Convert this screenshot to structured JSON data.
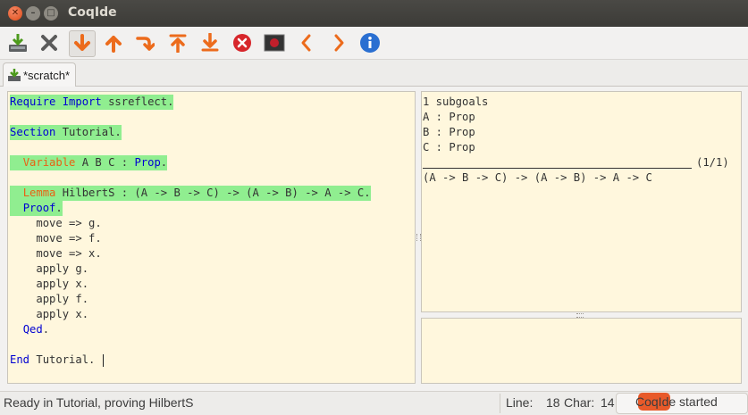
{
  "window": {
    "title": "CoqIde"
  },
  "toolbar": {
    "buttons": [
      {
        "name": "save-icon",
        "tooltip": ""
      },
      {
        "name": "close-icon",
        "tooltip": ""
      },
      {
        "name": "forward-one-icon",
        "tooltip": ""
      },
      {
        "name": "backward-one-icon",
        "tooltip": ""
      },
      {
        "name": "go-to-cursor-icon",
        "tooltip": ""
      },
      {
        "name": "restart-icon",
        "tooltip": ""
      },
      {
        "name": "go-to-end-icon",
        "tooltip": ""
      },
      {
        "name": "interrupt-icon",
        "tooltip": ""
      },
      {
        "name": "stop-icon",
        "tooltip": ""
      },
      {
        "name": "previous-icon",
        "tooltip": ""
      },
      {
        "name": "next-icon",
        "tooltip": ""
      },
      {
        "name": "about-icon",
        "tooltip": ""
      }
    ]
  },
  "tabs": [
    {
      "label": "*scratch*"
    }
  ],
  "editor": {
    "lines": [
      {
        "kw": "Require Import",
        "kw_color": "blue",
        "rest": " ssreflect.",
        "processed": true
      },
      {
        "kw": "",
        "rest": "",
        "processed": false
      },
      {
        "kw": "Section",
        "kw_color": "blue",
        "rest": " Tutorial.",
        "processed": true
      },
      {
        "kw": "",
        "rest": "",
        "processed": false
      },
      {
        "indent": "  ",
        "kw": "Variable",
        "kw_color": "orange",
        "rest": " A B C : ",
        "kw2": "Prop",
        "rest2": ".",
        "processed": true
      },
      {
        "kw": "",
        "rest": "",
        "processed": false
      },
      {
        "indent": "  ",
        "kw": "Lemma",
        "kw_color": "orange",
        "rest": " HilbertS : (A -> B -> C) -> (A -> B) -> A -> C.",
        "processed": true
      },
      {
        "indent": "  ",
        "kw": "Proof",
        "kw_color": "blue",
        "rest": ".",
        "processed": true
      },
      {
        "indent": "    ",
        "kw": "",
        "rest": "move => g.",
        "processed": false
      },
      {
        "indent": "    ",
        "kw": "",
        "rest": "move => f.",
        "processed": false
      },
      {
        "indent": "    ",
        "kw": "",
        "rest": "move => x.",
        "processed": false
      },
      {
        "indent": "    ",
        "kw": "",
        "rest": "apply g.",
        "processed": false
      },
      {
        "indent": "    ",
        "kw": "",
        "rest": "apply x.",
        "processed": false
      },
      {
        "indent": "    ",
        "kw": "",
        "rest": "apply f.",
        "processed": false
      },
      {
        "indent": "    ",
        "kw": "",
        "rest": "apply x.",
        "processed": false
      },
      {
        "indent": "  ",
        "kw": "Qed",
        "kw_color": "blue",
        "rest": ".",
        "processed": false
      },
      {
        "kw": "",
        "rest": "",
        "processed": false
      },
      {
        "kw": "End",
        "kw_color": "blue",
        "rest": " Tutorial.",
        "processed": false
      }
    ]
  },
  "goals": {
    "count_text": "1 subgoals",
    "hypotheses": [
      "A : Prop",
      "B : Prop",
      "C : Prop"
    ],
    "goal_index": "(1/1)",
    "goal": "(A -> B -> C) -> (A -> B) -> A -> C"
  },
  "status": {
    "message": "Ready in Tutorial, proving HilbertS",
    "line_label": "Line:",
    "line_value": "18",
    "char_label": "Char:",
    "char_value": "14",
    "notification": "CoqIde started"
  },
  "colors": {
    "processed_highlight": "#90ee90",
    "keyword_blue": "#0000d2",
    "keyword_orange": "#e86114",
    "buffer_background": "#fff7dd"
  }
}
